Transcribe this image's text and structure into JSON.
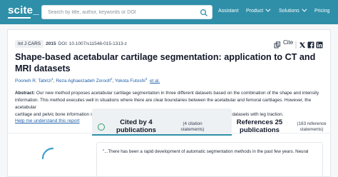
{
  "header": {
    "logo": "scite_",
    "search_placeholder": "Search by title, author, keywords or DOI",
    "nav": {
      "assistant": "Assistant",
      "product": "Product",
      "solutions": "Solutions",
      "pricing": "Pricing"
    }
  },
  "article": {
    "journal": "Int J CARS",
    "year": "2015",
    "doi": "DOI: 10.1007/s11548-015-1313-z",
    "cite_link": "Cite",
    "title": "Shape-based acetabular cartilage segmentation: application to CT and MRI datasets",
    "authors": [
      {
        "name": "Pooneh R. Tabrizi",
        "sup": "1"
      },
      {
        "name": "Reza Aghaeizadeh Zoroofi",
        "sup": "2"
      },
      {
        "name": "Yokota Futoshi",
        "sup": "3"
      }
    ],
    "et_al": "et al.",
    "abstract_label": "Abstract:",
    "abstract_lines": [
      "Our new method proposes acetabular cartilage segmentation in three different datasets based on the combination of the shape and intensity",
      "information. This method executes well in situations where there are clear boundaries between the acetabular and femoral cartilages. However, the acetabular",
      "cartilage and pelvic bone information should be obtained from one dataset such as CT arthrography or MRI datasets with leg traction."
    ],
    "help_link": "Help me understand this report"
  },
  "stats": {
    "cited_by": "Cited by 4",
    "cited_by_unit": "publications",
    "citation_statements": "(4 citation",
    "citation_statements_2": "statements)",
    "references": "References 25",
    "references_unit": "publications",
    "reference_statements": "(163 reference",
    "reference_statements_2": "statements)"
  },
  "snippet": {
    "text": "\"...There has been a rapid development of automatic segmentation methods in the past few years. Neural"
  },
  "colors": {
    "brand": "#2f8fa9",
    "link": "#1f5fa8",
    "cite_icon": "#2f9d6a"
  },
  "icons": [
    "search-icon",
    "copy-icon",
    "twitter-icon",
    "facebook-icon",
    "linkedin-icon",
    "quote-icon",
    "spinner-icon",
    "filter-icon"
  ]
}
